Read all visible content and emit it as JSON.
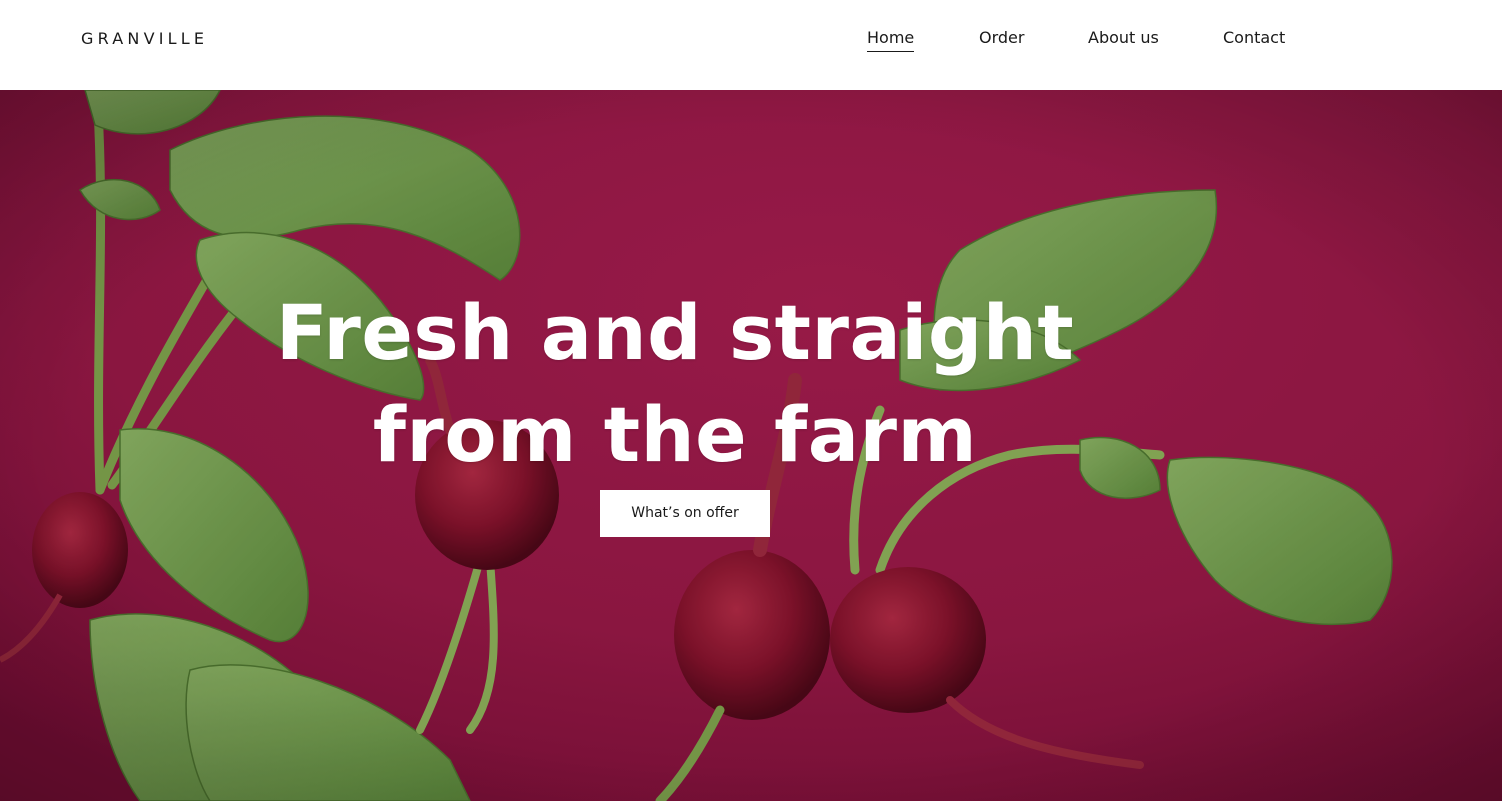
{
  "header": {
    "logo": "GRANVILLE",
    "nav": [
      {
        "label": "Home",
        "active": true
      },
      {
        "label": "Order",
        "active": false
      },
      {
        "label": "About us",
        "active": false
      },
      {
        "label": "Contact",
        "active": false
      }
    ]
  },
  "hero": {
    "title_line1": "Fresh and straight",
    "title_line2": "from the farm",
    "cta_label": "What’s on offer",
    "background_color": "#9c1a48",
    "image_subject": "radishes-with-leaves-photo"
  },
  "colors": {
    "text_dark": "#1a1a1a",
    "header_bg": "#ffffff",
    "hero_bg": "#9c1a48",
    "leaf_green": "#6f9a4a",
    "radish_red": "#8e1730"
  }
}
